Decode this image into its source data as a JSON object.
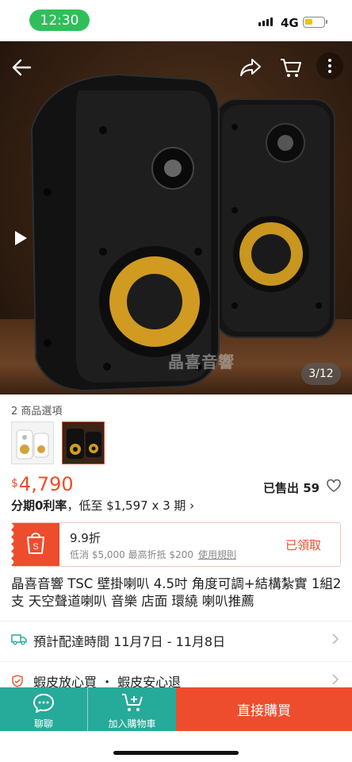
{
  "status_bar": {
    "time": "12:30",
    "network": "4G"
  },
  "gallery": {
    "watermark": "晶喜音響",
    "counter": "3/12"
  },
  "options": {
    "label": "2 商品選項"
  },
  "price": {
    "currency": "$",
    "amount": "4,790",
    "sold": "已售出 59"
  },
  "installment": {
    "bold": "分期0利率",
    "rest": "，低至 $1,597 x 3 期 ›"
  },
  "voucher": {
    "title": "9.9折",
    "condition": "低消 $5,000 最高折抵 $200",
    "rules_link": "使用規則",
    "claim_label": "已領取"
  },
  "product": {
    "title": "晶喜音響 TSC 壁掛喇叭 4.5吋 角度可調+結構紮實 1組2支 天空聲道喇叭 音樂 店面 環繞 喇叭推薦"
  },
  "shipping": {
    "label": "預計配達時間 11月7日 - 11月8日"
  },
  "guarantee": {
    "label": "蝦皮放心買 ・ 蝦皮安心退"
  },
  "bottom_bar": {
    "chat_label": "聊聊",
    "cart_label": "加入購物車",
    "buy_label": "直接購買"
  },
  "colors": {
    "accent": "#ee4d2d",
    "teal": "#26aa99",
    "status_green": "#2fbf5a"
  }
}
